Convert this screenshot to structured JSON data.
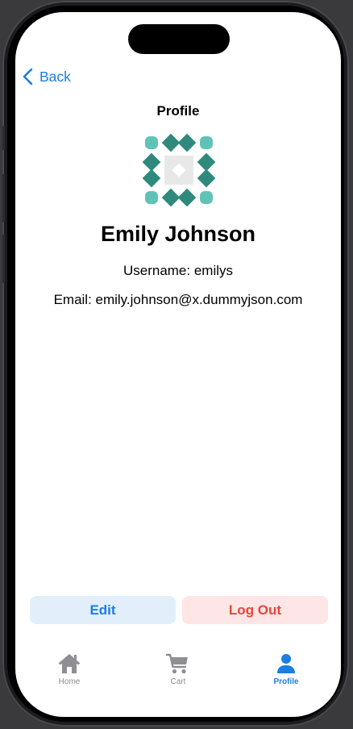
{
  "nav": {
    "back_label": "Back",
    "title": "Profile"
  },
  "profile": {
    "name": "Emily Johnson",
    "username_line": "Username: emilys",
    "email_line": "Email: emily.johnson@x.dummyjson.com",
    "avatar_colors": {
      "dark": "#2f8a7d",
      "light": "#5fc4b6",
      "center": "#e8e8e8"
    }
  },
  "actions": {
    "edit_label": "Edit",
    "logout_label": "Log Out"
  },
  "tabbar": {
    "items": [
      {
        "label": "Home",
        "icon": "house-icon",
        "active": false
      },
      {
        "label": "Cart",
        "icon": "cart-icon",
        "active": false
      },
      {
        "label": "Profile",
        "icon": "person-icon",
        "active": true
      }
    ],
    "active_color": "#1a7fe0",
    "inactive_color": "#8e8e93"
  }
}
